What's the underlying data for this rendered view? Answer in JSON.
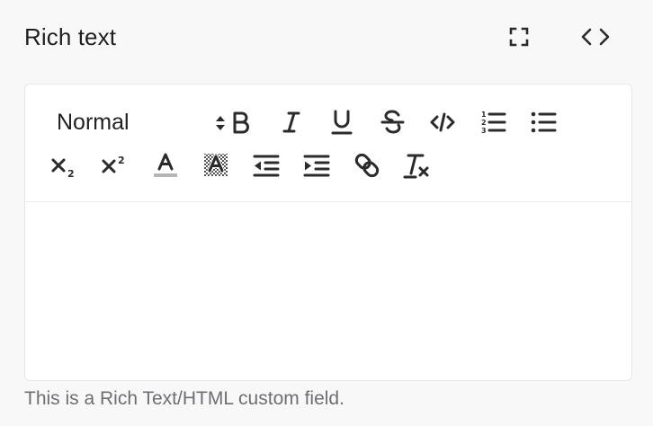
{
  "field": {
    "title": "Rich text",
    "help_text": "This is a Rich Text/HTML custom field."
  },
  "header": {
    "fullscreen_icon": "fullscreen-icon",
    "source_icon": "code-brackets-icon"
  },
  "toolbar": {
    "format_select": {
      "selected": "Normal"
    },
    "row1": [
      "bold",
      "italic",
      "underline",
      "strikethrough",
      "code",
      "ordered-list",
      "bullet-list"
    ],
    "row2": [
      "subscript",
      "superscript",
      "text-color",
      "background-color",
      "outdent",
      "indent",
      "link",
      "clear-format"
    ]
  },
  "editor": {
    "content": ""
  },
  "colors": {
    "background": "#f8f8f8",
    "editor_bg": "#ffffff",
    "border": "#e6e6e6",
    "icon": "#2b2b2b",
    "help_text": "#6e6e73"
  }
}
